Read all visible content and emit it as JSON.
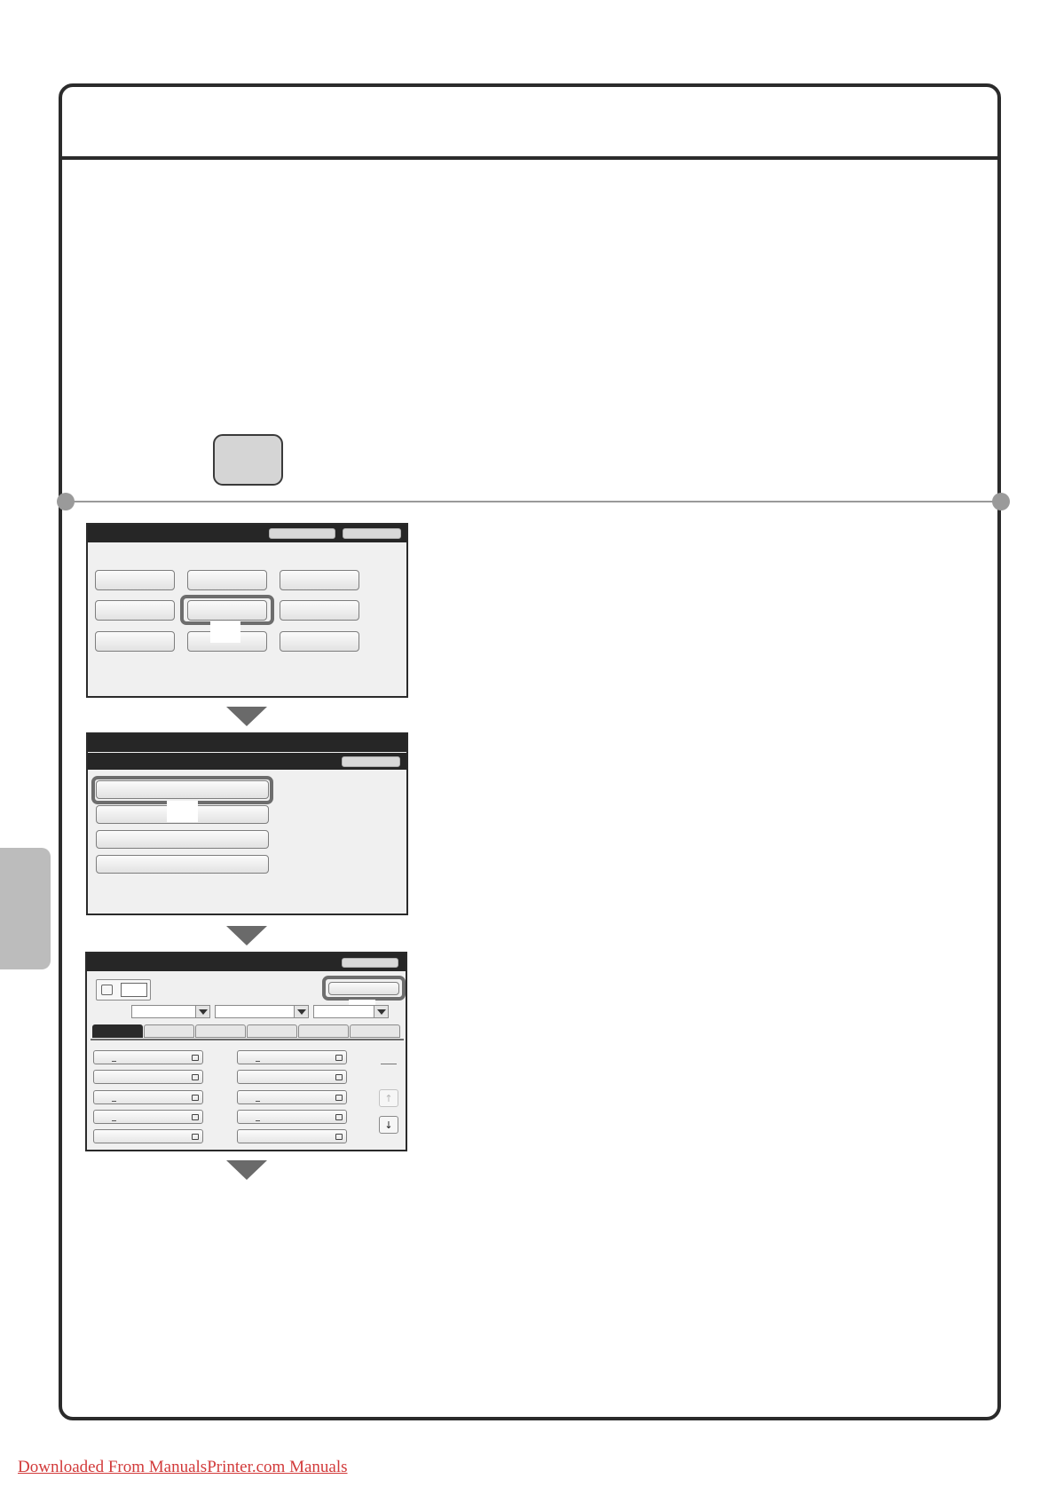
{
  "footer": {
    "link_text": "Downloaded From ManualsPrinter.com Manuals",
    "link_color": "#d23a3a"
  },
  "colors": {
    "frame": "#2b2b2b",
    "screen_title_bar": "#262626",
    "highlight": "#6d6d6d",
    "side_tab": "#bcbcbc"
  },
  "address_book": {
    "scroll_up_icon": "↑",
    "scroll_down_icon": "↓"
  }
}
